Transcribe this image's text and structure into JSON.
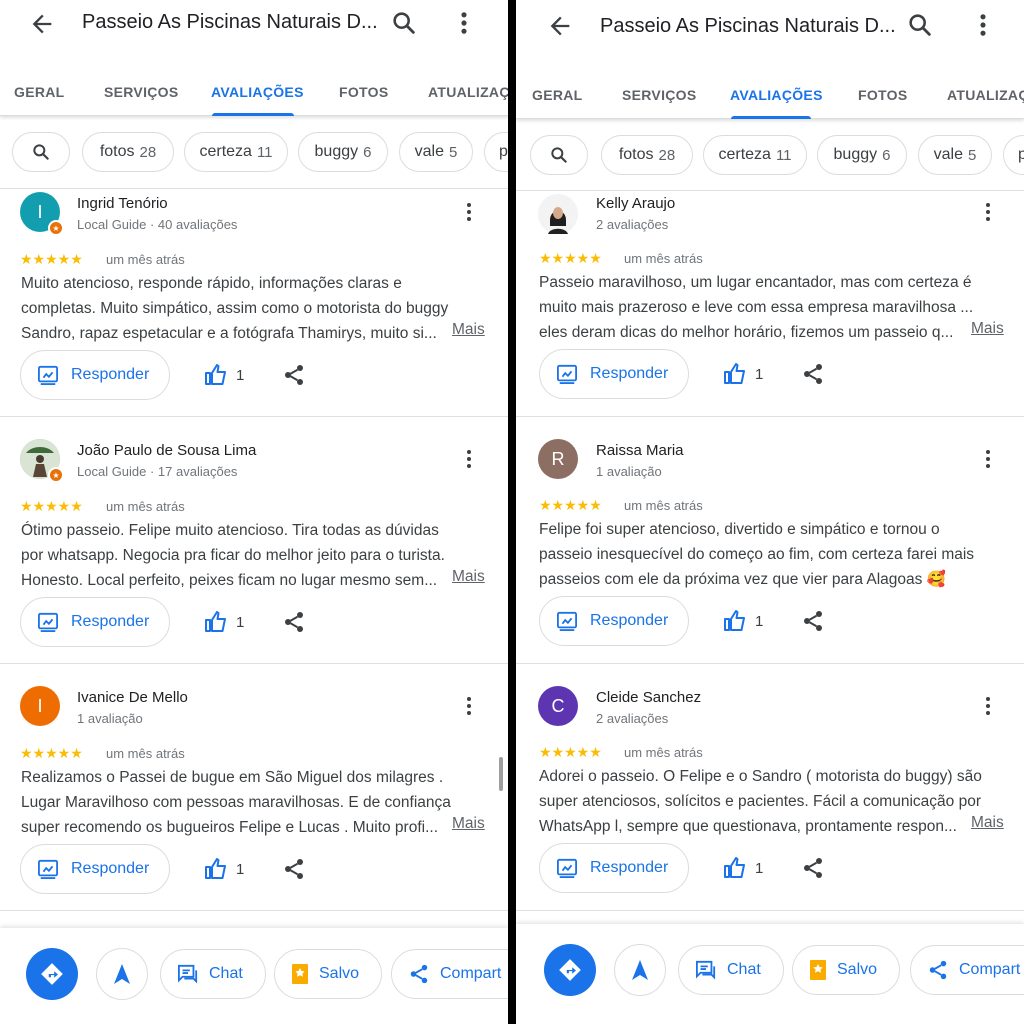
{
  "place_title": "Passeio As Piscinas Naturais D...",
  "tabs": [
    "GERAL",
    "SERVIÇOS",
    "AVALIAÇÕES",
    "FOTOS",
    "ATUALIZAÇÕ"
  ],
  "active_tab": "AVALIAÇÕES",
  "chips": [
    {
      "label": "fotos",
      "count": "28"
    },
    {
      "label": "certeza",
      "count": "11"
    },
    {
      "label": "buggy",
      "count": "6"
    },
    {
      "label": "vale",
      "count": "5"
    },
    {
      "label": "p",
      "count": ""
    }
  ],
  "reply_label": "Responder",
  "more_label": "Mais",
  "date_label": "um mês atrás",
  "stars": "★★★★★",
  "likes": "1",
  "left_reviews": [
    {
      "name": "Ingrid Tenório",
      "meta": "Local Guide · 40 avaliações",
      "initial": "I",
      "lines": [
        "Muito atencioso, responde rápido, informações claras e",
        "completas. Muito simpático, assim como o motorista do buggy",
        "Sandro, rapaz espetacular e a fotógrafa Thamirys, muito si..."
      ]
    },
    {
      "name": "João Paulo de Sousa Lima",
      "meta": "Local Guide · 17 avaliações",
      "initial": "",
      "lines": [
        "Ótimo passeio. Felipe muito atencioso. Tira todas as dúvidas",
        "por whatsapp. Negocia pra ficar do melhor jeito para o turista.",
        "Honesto. Local perfeito, peixes ficam no lugar mesmo sem..."
      ]
    },
    {
      "name": "Ivanice De Mello",
      "meta": "1 avaliação",
      "initial": "I",
      "lines": [
        "Realizamos  o Passei de bugue em São Miguel dos milagres .",
        "Lugar  Maravilhoso com pessoas maravilhosas. E de confiança",
        "super recomendo os bugueiros Felipe e Lucas . Muito profi..."
      ]
    }
  ],
  "right_reviews": [
    {
      "name": "Kelly Araujo",
      "meta": "2 avaliações",
      "initial": "",
      "lines": [
        "Passeio maravilhoso, um lugar encantador, mas com certeza é",
        "muito mais prazeroso e leve com essa empresa maravilhosa ...",
        "eles deram dicas do melhor horário, fizemos um passeio q..."
      ]
    },
    {
      "name": "Raissa Maria",
      "meta": "1 avaliação",
      "initial": "R",
      "lines": [
        "Felipe foi super atencioso, divertido e simpático e tornou o",
        "passeio inesquecível do começo ao fim, com certeza farei mais",
        "passeios com ele da próxima vez que vier para Alagoas 🥰"
      ]
    },
    {
      "name": "Cleide Sanchez",
      "meta": "2 avaliações",
      "initial": "C",
      "lines": [
        "Adorei o passeio. O Felipe e o Sandro ( motorista do buggy) são",
        "super atenciosos, solícitos e pacientes. Fácil a comunicação por",
        "WhatsApp l, sempre que questionava, prontamente respon..."
      ]
    }
  ],
  "bottom_actions": {
    "chat": "Chat",
    "saved": "Salvo",
    "share": "Compart"
  },
  "colors": {
    "accent": "#1a73e8",
    "star": "#fbbc04",
    "avatar_teal": "#129eaf",
    "avatar_orange": "#ef6c00",
    "avatar_brown": "#8d6e63",
    "avatar_purple": "#5e35b1"
  }
}
